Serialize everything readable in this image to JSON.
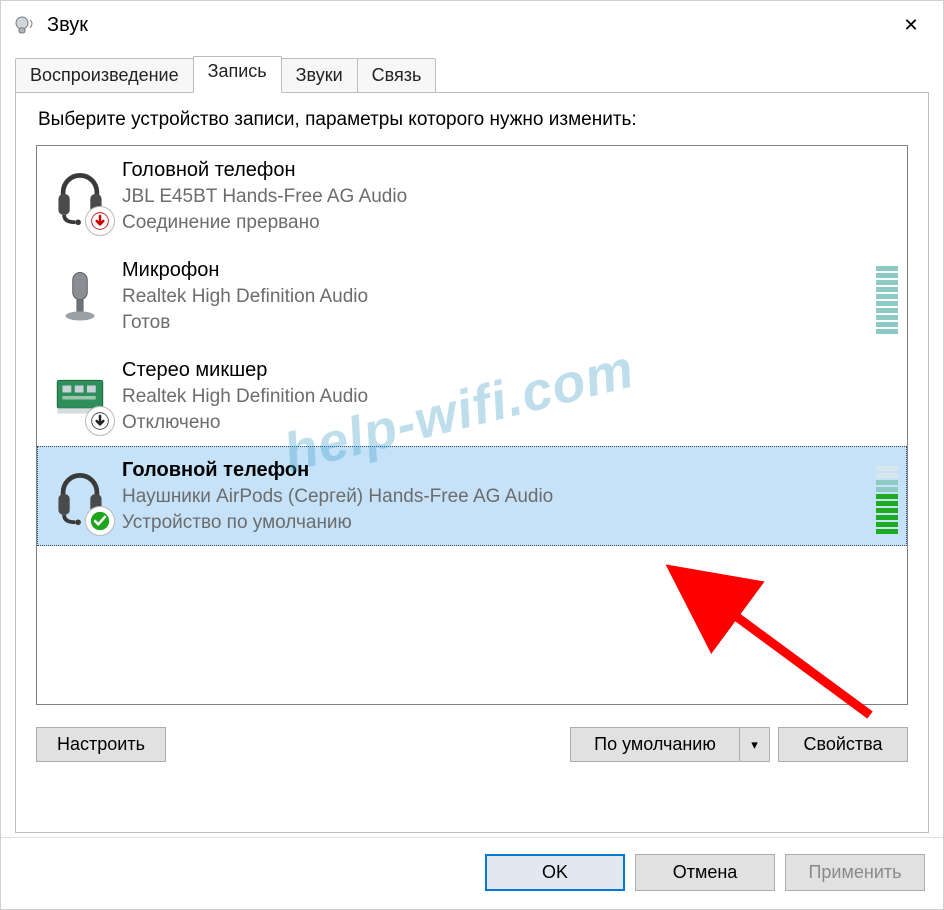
{
  "window": {
    "title": "Звук",
    "close_glyph": "✕"
  },
  "tabs": {
    "items": [
      {
        "label": "Воспроизведение"
      },
      {
        "label": "Запись"
      },
      {
        "label": "Звуки"
      },
      {
        "label": "Связь"
      }
    ],
    "active_index": 1
  },
  "instruction": "Выберите устройство записи, параметры которого нужно изменить:",
  "devices": [
    {
      "name": "Головной телефон",
      "subtitle": "JBL E45BT Hands-Free AG Audio",
      "status": "Соединение прервано",
      "icon": "headset",
      "badge": "down-arrow",
      "selected": false,
      "meter": null
    },
    {
      "name": "Микрофон",
      "subtitle": "Realtek High Definition Audio",
      "status": "Готов",
      "icon": "microphone",
      "badge": null,
      "selected": false,
      "meter": {
        "total": 10,
        "active": 0,
        "style": "teal"
      }
    },
    {
      "name": "Стерео микшер",
      "subtitle": "Realtek High Definition Audio",
      "status": "Отключено",
      "icon": "soundcard",
      "badge": "disabled-arrow",
      "selected": false,
      "meter": null
    },
    {
      "name": "Головной телефон",
      "subtitle": "Наушники AirPods (Сергей) Hands-Free AG Audio",
      "status": "Устройство по умолчанию",
      "icon": "headset",
      "badge": "check",
      "selected": true,
      "meter": {
        "total": 10,
        "active": 6,
        "style": "green"
      }
    }
  ],
  "buttons": {
    "configure": "Настроить",
    "default": "По умолчанию",
    "properties": "Свойства",
    "ok": "OK",
    "cancel": "Отмена",
    "apply": "Применить"
  },
  "watermark": "help-wifi.com"
}
